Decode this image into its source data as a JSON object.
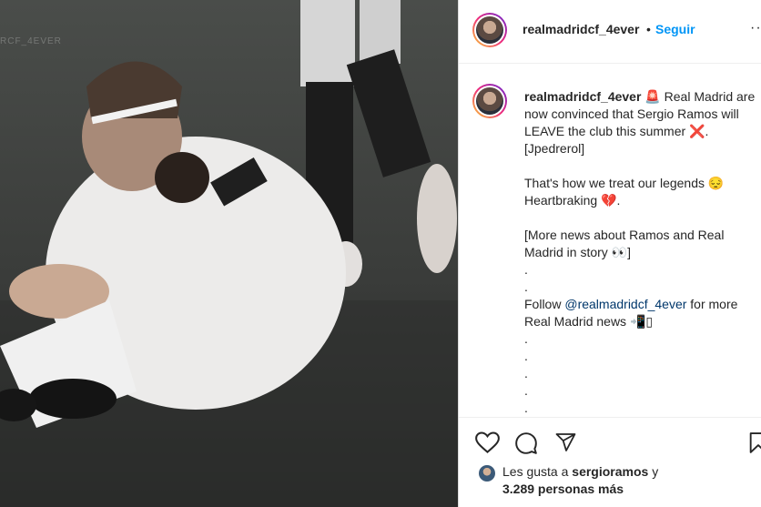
{
  "post": {
    "username": "realmadridcf_4ever",
    "follow_label": "Seguir",
    "separator": "•",
    "more_label": "···",
    "watermark": "RCF_4EVER"
  },
  "caption": {
    "username": "realmadridcf_4ever",
    "line1": " 🚨 Real Madrid are now convinced that Sergio Ramos will LEAVE the club this summer ❌. [Jpedrerol]",
    "line2": "That's how we treat our legends 😔 Heartbraking 💔.",
    "line3": "[More news about Ramos and Real Madrid in story 👀]",
    "dots_a": ".\n.",
    "follow_prefix": "Follow ",
    "follow_mention": "@realmadridcf_4ever",
    "follow_suffix": " for more Real Madrid news 📲▯",
    "dots_b": ".\n.\n.\n.\n."
  },
  "actions": {
    "icons": [
      "heart-icon",
      "comment-icon",
      "share-icon",
      "save-icon"
    ]
  },
  "likes": {
    "prefix": "Les gusta a ",
    "liker": "sergioramos",
    "middle": " y ",
    "count": "3.289 personas más"
  }
}
